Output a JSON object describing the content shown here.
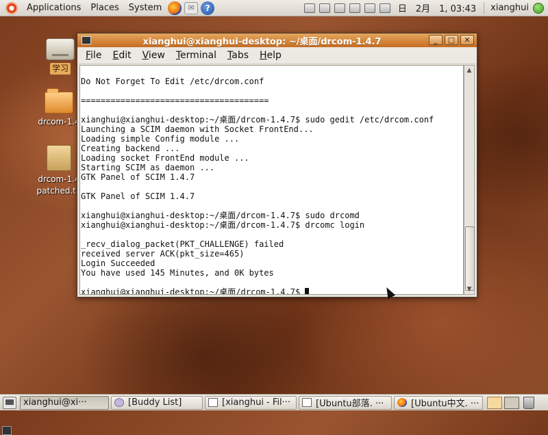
{
  "top_panel": {
    "menus": [
      "Applications",
      "Places",
      "System"
    ],
    "clock": "日　2月　1, 03:43",
    "user": "xianghui"
  },
  "desktop": {
    "icons": [
      {
        "label": "学习",
        "icon": "drive-icon",
        "selected": true
      },
      {
        "label": "drcom-1.4",
        "icon": "folder-icon"
      },
      {
        "label_lines": [
          "drcom-1.4",
          "patched.ta"
        ],
        "icon": "archive-icon"
      }
    ]
  },
  "terminal": {
    "title": "xianghui@xianghui-desktop: ~/桌面/drcom-1.4.7",
    "menu": [
      {
        "label": "File",
        "u": "F",
        "rest": "ile"
      },
      {
        "label": "Edit",
        "u": "E",
        "rest": "dit"
      },
      {
        "label": "View",
        "u": "V",
        "rest": "iew"
      },
      {
        "label": "Terminal",
        "u": "T",
        "rest": "erminal"
      },
      {
        "label": "Tabs",
        "u": "T",
        "rest": "abs"
      },
      {
        "label": "Help",
        "u": "H",
        "rest": "elp"
      }
    ],
    "lines": [
      "",
      "Do Not Forget To Edit /etc/drcom.conf",
      "",
      "======================================",
      "",
      "xianghui@xianghui-desktop:~/桌面/drcom-1.4.7$ sudo gedit /etc/drcom.conf",
      "Launching a SCIM daemon with Socket FrontEnd...",
      "Loading simple Config module ...",
      "Creating backend ...",
      "Loading socket FrontEnd module ...",
      "Starting SCIM as daemon ...",
      "GTK Panel of SCIM 1.4.7",
      "",
      "GTK Panel of SCIM 1.4.7",
      "",
      "xianghui@xianghui-desktop:~/桌面/drcom-1.4.7$ sudo drcomd",
      "xianghui@xianghui-desktop:~/桌面/drcom-1.4.7$ drcomc login",
      "",
      "_recv_dialog_packet(PKT_CHALLENGE) failed",
      "received server ACK(pkt_size=465)",
      "Login Succeeded",
      "You have used 145 Minutes, and 0K bytes",
      "",
      "xianghui@xianghui-desktop:~/桌面/drcom-1.4.7$ "
    ]
  },
  "taskbar": {
    "tasks": [
      {
        "label": "xianghui@xi···",
        "icon": "terminal-icon",
        "active": true
      },
      {
        "label": "[Buddy List]",
        "icon": "buddy-icon",
        "active": false
      },
      {
        "label": "[xianghui - Fil···",
        "icon": "file-icon",
        "active": false
      },
      {
        "label": "[Ubuntu部落. ···",
        "icon": "page-icon",
        "active": false
      },
      {
        "label": "[Ubuntu中文. ···",
        "icon": "firefox-icon",
        "active": false
      }
    ]
  }
}
